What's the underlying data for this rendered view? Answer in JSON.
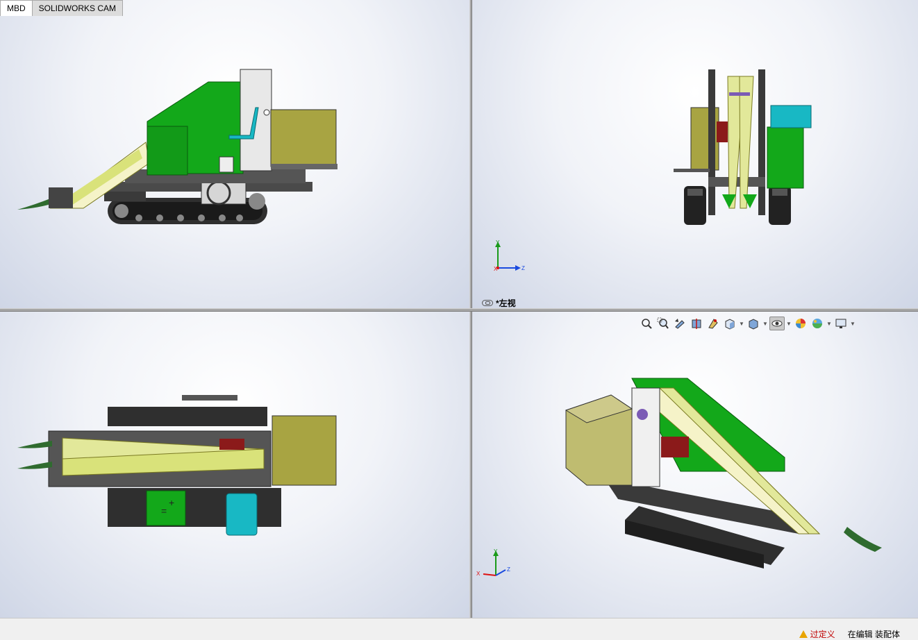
{
  "tabs": [
    {
      "label": "MBD",
      "active": true
    },
    {
      "label": "SOLIDWORKS CAM",
      "active": false
    }
  ],
  "viewports": {
    "top_left": {
      "view": "front"
    },
    "top_right": {
      "view": "left",
      "label": "*左视",
      "triad": {
        "y": "Y",
        "x": "X",
        "z": "Z"
      }
    },
    "bottom_left": {
      "view": "top"
    },
    "bottom_right": {
      "view": "isometric",
      "triad": {
        "y": "Y",
        "x": "X",
        "z": "Z"
      }
    }
  },
  "heads_up_toolbar": {
    "buttons": [
      {
        "icon": "zoom-to-fit-icon"
      },
      {
        "icon": "zoom-to-area-icon"
      },
      {
        "icon": "previous-view-icon"
      },
      {
        "icon": "section-view-icon"
      },
      {
        "icon": "dynamic-annotation-views-icon"
      },
      {
        "icon": "view-orientation-icon",
        "dropdown": true
      },
      {
        "icon": "display-style-icon",
        "dropdown": true
      },
      {
        "icon": "hide-show-items-icon",
        "dropdown": true,
        "pressed": true
      },
      {
        "icon": "edit-appearance-icon"
      },
      {
        "icon": "apply-scene-icon",
        "dropdown": true
      },
      {
        "icon": "view-settings-icon",
        "dropdown": true
      }
    ]
  },
  "status_bar": {
    "warning_text": "过定义",
    "mode_text": "在编辑 装配体"
  },
  "colors": {
    "green": "#13a81a",
    "olive_box": "#a8a442",
    "yellow_belt": "#e2e89a",
    "dark_frame": "#3a3a3a",
    "teal_seat": "#18b8c4",
    "red_motor": "#8b1a1a"
  }
}
